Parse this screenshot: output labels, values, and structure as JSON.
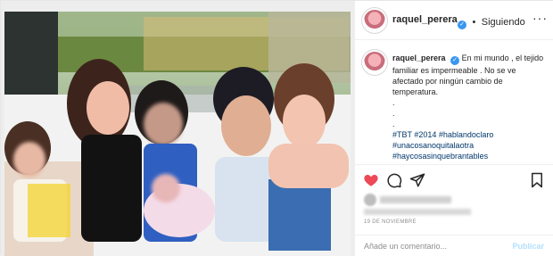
{
  "header": {
    "username": "raquel_perera",
    "separator": "•",
    "follow_status": "Siguiendo",
    "more_label": "···"
  },
  "caption": {
    "username": "raquel_perera",
    "text": "En mi mundo , el tejido familiar es impermeable . No se ve afectado por ningún cambio de temperatura.",
    "dots": [
      ".",
      ".",
      "."
    ],
    "hashtags": [
      "#TBT #2014 #hablandoclaro",
      "#unacosanoquitalaotra",
      "#haycosasinquebrantables"
    ]
  },
  "date": "19 DE NOVIEMBRE",
  "comment": {
    "placeholder": "Añade un comentario...",
    "publish_label": "Publicar"
  },
  "colors": {
    "verified": "#3897f0",
    "heart": "#ed4956",
    "hashtag": "#00376b",
    "publish": "#b2dffc"
  },
  "icons": {
    "like": "heart-icon",
    "comment": "comment-icon",
    "share": "send-icon",
    "save": "bookmark-icon",
    "verified": "verified-badge-icon"
  }
}
